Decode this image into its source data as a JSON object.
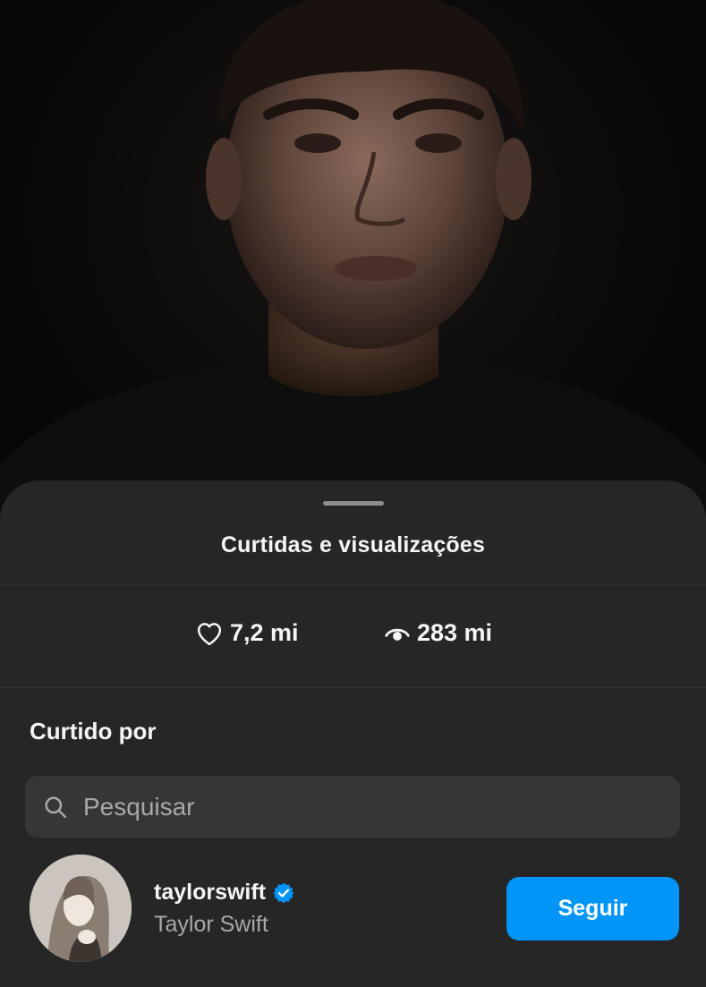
{
  "sheet": {
    "title": "Curtidas e visualizações"
  },
  "stats": {
    "likes_icon": "heart-outline-icon",
    "likes": "7,2 mi",
    "views_icon": "eye-icon",
    "views": "283 mi"
  },
  "liked_by": {
    "label": "Curtido por",
    "search": {
      "icon": "search-icon",
      "placeholder": "Pesquisar",
      "value": ""
    },
    "users": [
      {
        "username": "taylorswift",
        "full_name": "Taylor Swift",
        "verified": true,
        "follow_label": "Seguir"
      }
    ]
  },
  "colors": {
    "sheet_bg": "#262626",
    "accent": "#0095f6",
    "text_primary": "#f5f5f5",
    "text_secondary": "#a8a8a8",
    "search_bg": "#363636"
  }
}
